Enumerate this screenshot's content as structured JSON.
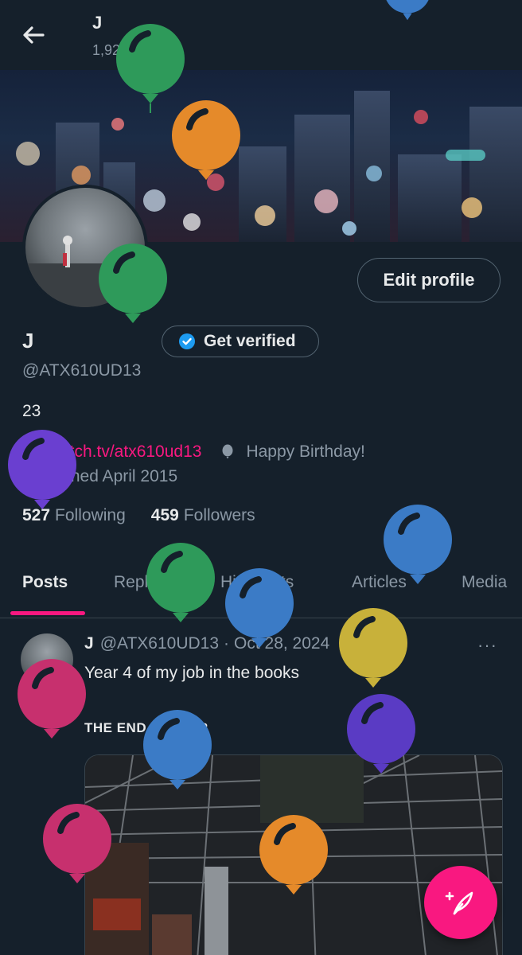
{
  "header": {
    "name": "J",
    "posts_count": "1,929 posts"
  },
  "profile": {
    "name": "J",
    "handle": "@ATX610UD13",
    "bio": "23",
    "link": "twitch.tv/atx610ud13",
    "birthday": "Happy Birthday!",
    "joined": "Joined April 2015",
    "following_count": "527",
    "following_label": "Following",
    "followers_count": "459",
    "followers_label": "Followers",
    "edit_profile_label": "Edit profile",
    "get_verified_label": "Get verified"
  },
  "tabs": [
    {
      "label": "Posts"
    },
    {
      "label": "Replies"
    },
    {
      "label": "Highlights"
    },
    {
      "label": "Articles"
    },
    {
      "label": "Media"
    }
  ],
  "tweet": {
    "name": "J",
    "handle": "@ATX610UD13",
    "separator": "·",
    "date": "Oct 28, 2024",
    "more": "···",
    "text": "Year 4 of my job in the books",
    "text2": "THE END IS NEAR"
  },
  "icons": {
    "back": "arrow-left-icon",
    "verified": "verified-badge-icon",
    "link": "link-icon",
    "birthday": "balloon-icon",
    "calendar": "calendar-icon",
    "compose": "compose-feather-icon"
  },
  "colors": {
    "background": "#15202b",
    "accent": "#f91880",
    "muted": "#8b98a5",
    "verified": "#1d9bf0"
  }
}
